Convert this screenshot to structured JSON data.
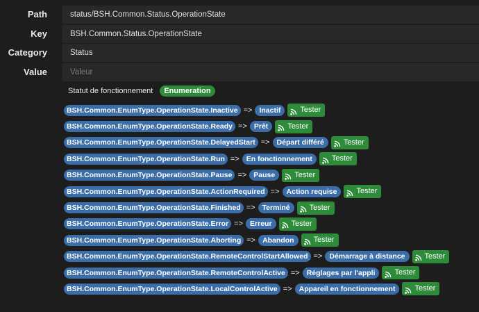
{
  "fields": [
    {
      "label": "Path",
      "value": "status/BSH.Common.Status.OperationState",
      "placeholder": ""
    },
    {
      "label": "Key",
      "value": "BSH.Common.Status.OperationState",
      "placeholder": ""
    },
    {
      "label": "Category",
      "value": "Status",
      "placeholder": ""
    },
    {
      "label": "Value",
      "value": "",
      "placeholder": "Valeur"
    }
  ],
  "enum_header": {
    "title": "Statut de fonctionnement",
    "type_badge": "Enumeration"
  },
  "arrow": "=>",
  "tester_label": "Tester",
  "tester_icon": "rss-icon",
  "colors": {
    "pill_blue": "#3b6ea8",
    "tester_green": "#2e8b3a",
    "background": "#1d1d1d",
    "input_bg": "#282828"
  },
  "enum_values": [
    {
      "key": "BSH.Common.EnumType.OperationState.Inactive",
      "label": "Inactif"
    },
    {
      "key": "BSH.Common.EnumType.OperationState.Ready",
      "label": "Prêt"
    },
    {
      "key": "BSH.Common.EnumType.OperationState.DelayedStart",
      "label": "Départ différé"
    },
    {
      "key": "BSH.Common.EnumType.OperationState.Run",
      "label": "En fonctionnement"
    },
    {
      "key": "BSH.Common.EnumType.OperationState.Pause",
      "label": "Pause"
    },
    {
      "key": "BSH.Common.EnumType.OperationState.ActionRequired",
      "label": "Action requise"
    },
    {
      "key": "BSH.Common.EnumType.OperationState.Finished",
      "label": "Terminé"
    },
    {
      "key": "BSH.Common.EnumType.OperationState.Error",
      "label": "Erreur"
    },
    {
      "key": "BSH.Common.EnumType.OperationState.Aborting",
      "label": "Abandon"
    },
    {
      "key": "BSH.Common.EnumType.OperationState.RemoteControlStartAllowed",
      "label": "Démarrage à distance"
    },
    {
      "key": "BSH.Common.EnumType.OperationState.RemoteControlActive",
      "label": "Réglages par l'appli"
    },
    {
      "key": "BSH.Common.EnumType.OperationState.LocalControlActive",
      "label": "Appareil en fonctionnement"
    }
  ]
}
